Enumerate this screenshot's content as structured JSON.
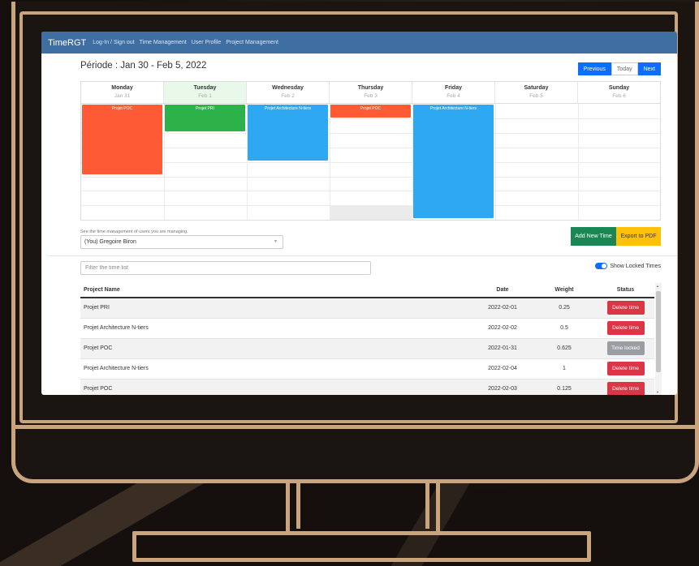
{
  "navbar": {
    "brand": "TimeRGT",
    "links": [
      "Log-In / Sign out",
      "Time Management",
      "User Profile",
      "Project Management"
    ]
  },
  "period": {
    "title": "Période : Jan 30 - Feb 5, 2022",
    "buttons": {
      "previous": "Previous",
      "today": "Today",
      "next": "Next"
    }
  },
  "calendar": {
    "days": [
      {
        "name": "Monday",
        "date": "Jan 31"
      },
      {
        "name": "Tuesday",
        "date": "Feb 1"
      },
      {
        "name": "Wednesday",
        "date": "Feb 2"
      },
      {
        "name": "Thursday",
        "date": "Feb 3"
      },
      {
        "name": "Friday",
        "date": "Feb 4"
      },
      {
        "name": "Saturday",
        "date": "Feb 5"
      },
      {
        "name": "Sunday",
        "date": "Feb 6"
      }
    ],
    "events": [
      {
        "label": "Projet POC",
        "day": 0,
        "color": "#ff5a36"
      },
      {
        "label": "Projet PRI",
        "day": 1,
        "color": "#2db24a"
      },
      {
        "label": "Projet Architecture N-tiers",
        "day": 2,
        "color": "#2fa8f2"
      },
      {
        "label": "Projet POC",
        "day": 3,
        "color": "#ff5a36"
      },
      {
        "label": "Projet Architecture N-tiers",
        "day": 4,
        "color": "#2fa8f2"
      }
    ]
  },
  "users": {
    "label": "See the time management of users you are managing.",
    "selected": "(You) Gregoire Biron"
  },
  "actions": {
    "add": "Add New Time",
    "export": "Export to PDF"
  },
  "filter": {
    "placeholder": "Filter the time list"
  },
  "toggle": {
    "label": "Show Locked Times",
    "on": true
  },
  "table": {
    "headers": [
      "Project Name",
      "Date",
      "Weight",
      "Status"
    ],
    "rows": [
      {
        "project": "Projet PRI",
        "date": "2022-02-01",
        "weight": "0.25",
        "status": "Delete time"
      },
      {
        "project": "Projet Architecture N-tiers",
        "date": "2022-02-02",
        "weight": "0.5",
        "status": "Delete time"
      },
      {
        "project": "Projet POC",
        "date": "2022-01-31",
        "weight": "0.625",
        "status": "Time locked"
      },
      {
        "project": "Projet Architecture N-tiers",
        "date": "2022-02-04",
        "weight": "1",
        "status": "Delete time"
      },
      {
        "project": "Projet POC",
        "date": "2022-02-03",
        "weight": "0.125",
        "status": "Delete time"
      }
    ]
  },
  "colors": {
    "navbar": "#3f6ea3",
    "primary": "#0d6efd",
    "success": "#198754",
    "warning": "#ffc107",
    "danger": "#dc3545",
    "locked": "#9a9ea3",
    "frame": "#c9a47c"
  }
}
